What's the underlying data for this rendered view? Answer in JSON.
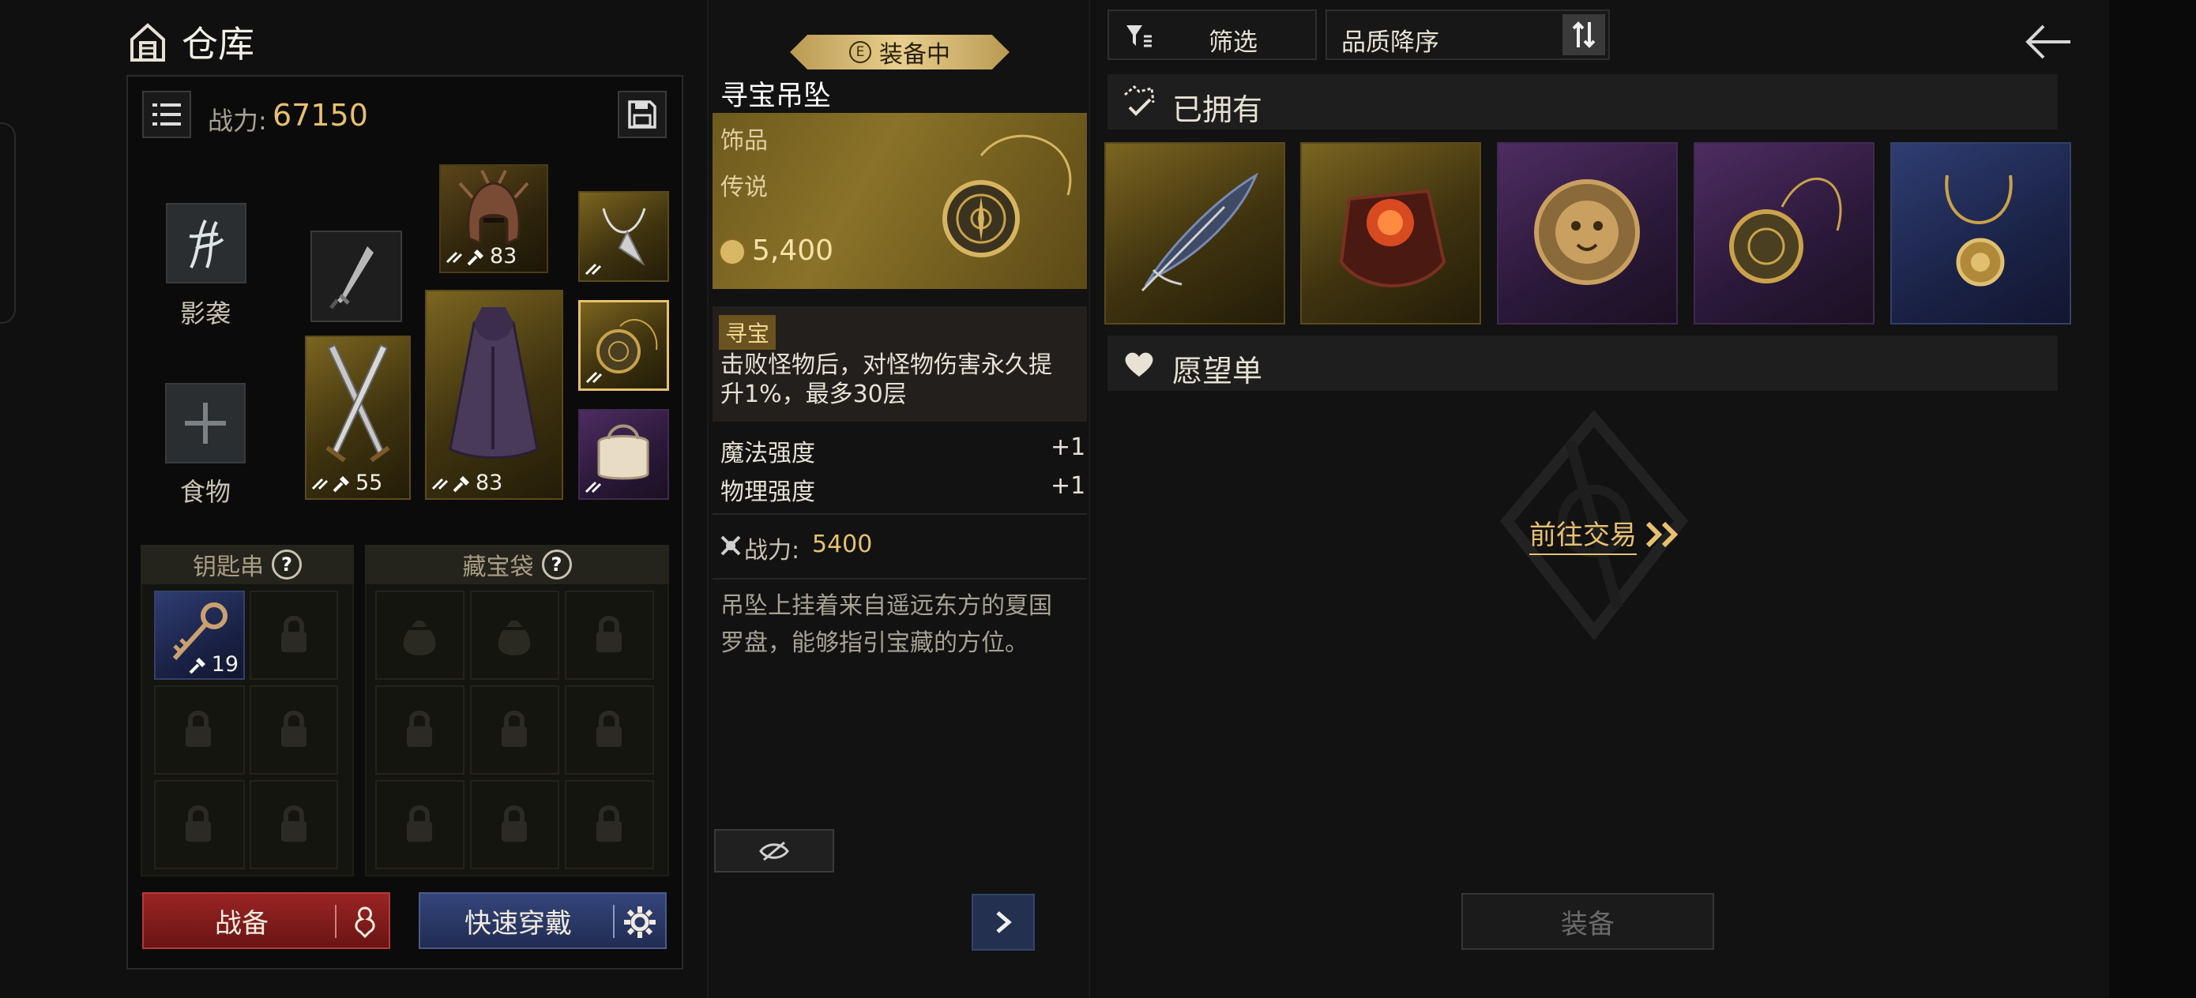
{
  "warehouse": {
    "title": "仓库",
    "power_label": "战力:",
    "power_value": "67150",
    "shadow_label": "影袭",
    "food_label": "食物",
    "helmet_level": "83",
    "armor_level": "83",
    "weapon_level": "55",
    "keyring_label": "钥匙串",
    "keyring_key_count": "19",
    "treasure_bag_label": "藏宝袋",
    "battle_button": "战备",
    "quick_equip_button": "快速穿戴"
  },
  "detail": {
    "equipped_badge": "装备中",
    "equipped_badge_icon": "E",
    "item_name": "寻宝吊坠",
    "category": "饰品",
    "rarity": "传说",
    "price": "5,400",
    "skill_tag": "寻宝",
    "skill_desc": "击败怪物后，对怪物伤害永久提升1%，最多30层",
    "stats": [
      {
        "name": "魔法强度",
        "value": "+1"
      },
      {
        "name": "物理强度",
        "value": "+1"
      }
    ],
    "power_label": "战力:",
    "power_value": "5400",
    "description": "吊坠上挂着来自遥远东方的夏国罗盘，能够指引宝藏的方位。"
  },
  "right": {
    "filter_button": "筛选",
    "sort_label": "品质降序",
    "owned_title": "已拥有",
    "wishlist_title": "愿望单",
    "trade_link": "前往交易",
    "equip_button": "装备",
    "owned_items": [
      {
        "icon": "feather-icon",
        "rarity": "gold"
      },
      {
        "icon": "red-gem-icon",
        "rarity": "gold"
      },
      {
        "icon": "lion-ring-icon",
        "rarity": "purple"
      },
      {
        "icon": "compass-pendant-icon",
        "rarity": "purple"
      },
      {
        "icon": "gold-necklace-icon",
        "rarity": "blue"
      }
    ]
  },
  "colors": {
    "accent_gold": "#e8c070",
    "battle_red": "#8c1f1f",
    "quick_blue": "#2a3866",
    "legendary_gold": "#7b6520",
    "epic_purple": "#4e2c62",
    "rare_blue": "#2f3d72"
  }
}
